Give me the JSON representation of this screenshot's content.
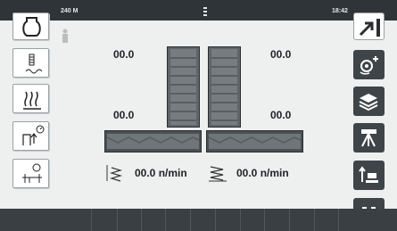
{
  "status": {
    "left_text": "240 M",
    "time": "18:42"
  },
  "left_nav": [
    {
      "name": "tank-icon"
    },
    {
      "name": "seed-level-sensor-icon"
    },
    {
      "name": "heating-icon"
    },
    {
      "name": "hydraulic-pressure-icon"
    },
    {
      "name": "seed-meter-icon"
    }
  ],
  "right_nav": [
    {
      "name": "exit-arrow-icon"
    },
    {
      "name": "seed-meter-settings-icon"
    },
    {
      "name": "layers-icon"
    },
    {
      "name": "tripod-calibration-icon"
    },
    {
      "name": "raise-lower-icon"
    },
    {
      "name": "grid-menu-icon"
    }
  ],
  "values": {
    "top_left": "00.0",
    "top_right": "00.0",
    "mid_left": "00.0",
    "mid_right": "00.0"
  },
  "rates": {
    "left": "00.0 n/min",
    "right": "00.0 n/min"
  }
}
